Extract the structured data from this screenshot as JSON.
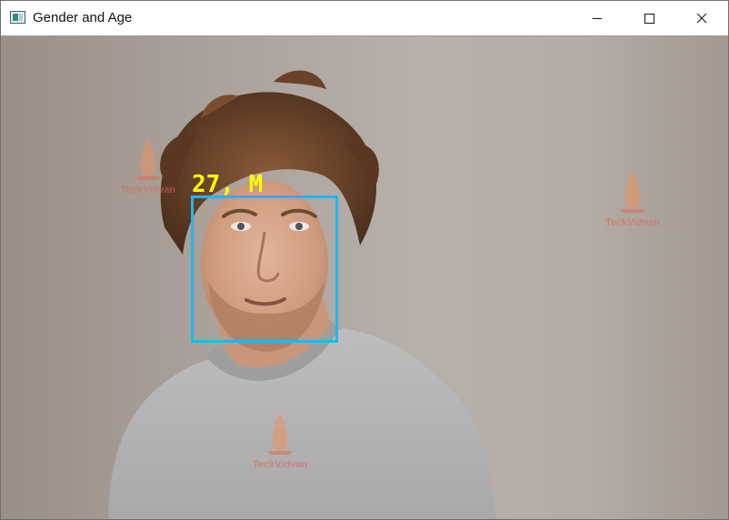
{
  "window": {
    "title": "Gender and Age",
    "icon": "app-window-icon",
    "controls": [
      "minimize-icon",
      "maximize-icon",
      "close-icon"
    ]
  },
  "detection": {
    "label": "27, M",
    "box_color": "#1eb9ea",
    "label_color": "#ffff00"
  },
  "watermarks": {
    "brand": "Teck",
    "brand_highlight": "Vidvan",
    "color": "#e06b3a"
  }
}
